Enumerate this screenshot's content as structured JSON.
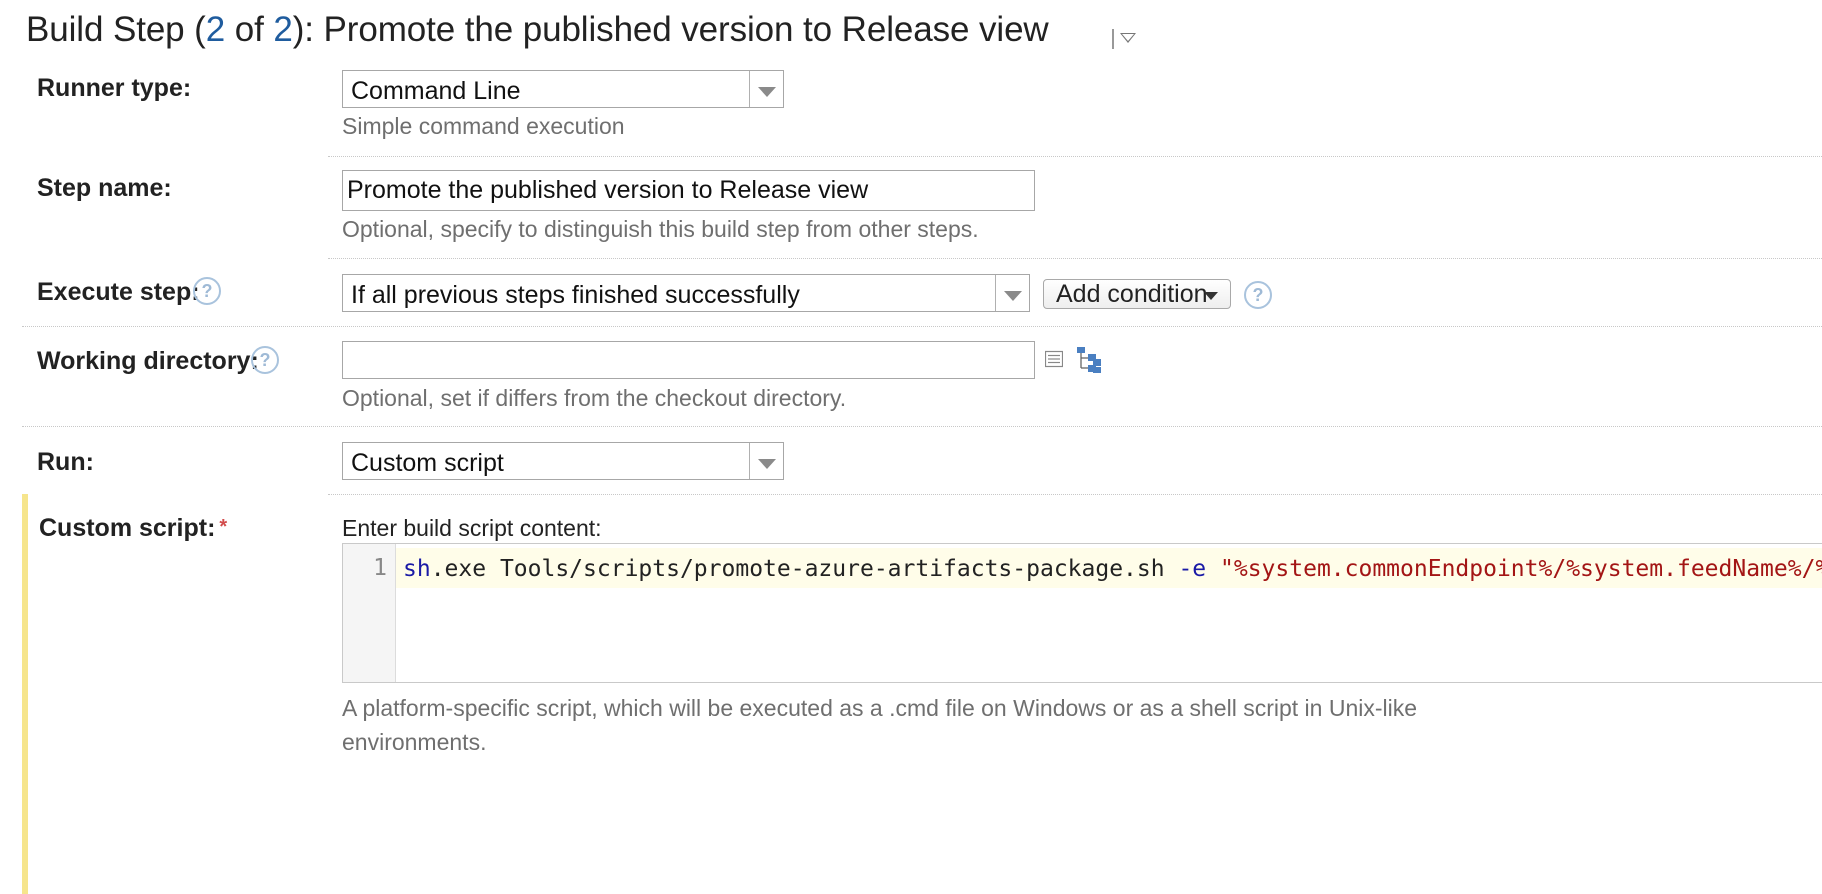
{
  "header": {
    "title_prefix": "Build Step (",
    "step_current": "2",
    "title_of": " of ",
    "step_total": "2",
    "title_suffix": "): Promote the published version to Release view"
  },
  "runner_type": {
    "label": "Runner type:",
    "value": "Command Line",
    "hint": "Simple command execution"
  },
  "step_name": {
    "label": "Step name:",
    "value": "Promote the published version to Release view",
    "hint": "Optional, specify to distinguish this build step from other steps."
  },
  "execute_step": {
    "label": "Execute step:",
    "value": "If all previous steps finished successfully",
    "add_condition_label": "Add condition"
  },
  "working_directory": {
    "label": "Working directory:",
    "value": "",
    "hint": "Optional, set if differs from the checkout directory."
  },
  "run": {
    "label": "Run:",
    "value": "Custom script"
  },
  "custom_script": {
    "label": "Custom script:",
    "required_mark": "*",
    "prompt": "Enter build script content:",
    "line_number": "1",
    "code_cmd": "sh",
    "code_rest": ".exe Tools/scripts/promote-azure-artifacts-package.sh ",
    "code_flag": "-e",
    "code_space": " ",
    "code_string": "\"%system.commonEndpoint%/%system.feedName%/%system.packageVersion%\"",
    "hint_line1": "A platform-specific script, which will be executed as a .cmd file on Windows or as a shell script in Unix-like",
    "hint_line2": "environments."
  },
  "help_icon_glyph": "?",
  "icons": [
    "dropdown-menu-icon",
    "help-icon",
    "list-icon",
    "directory-tree-icon",
    "chevron-down-icon"
  ],
  "colors": {
    "link_blue": "#1f5c9e",
    "required_bar": "#f6e58c",
    "required_star": "#d24c4c",
    "help_icon": "#9fbad6"
  }
}
